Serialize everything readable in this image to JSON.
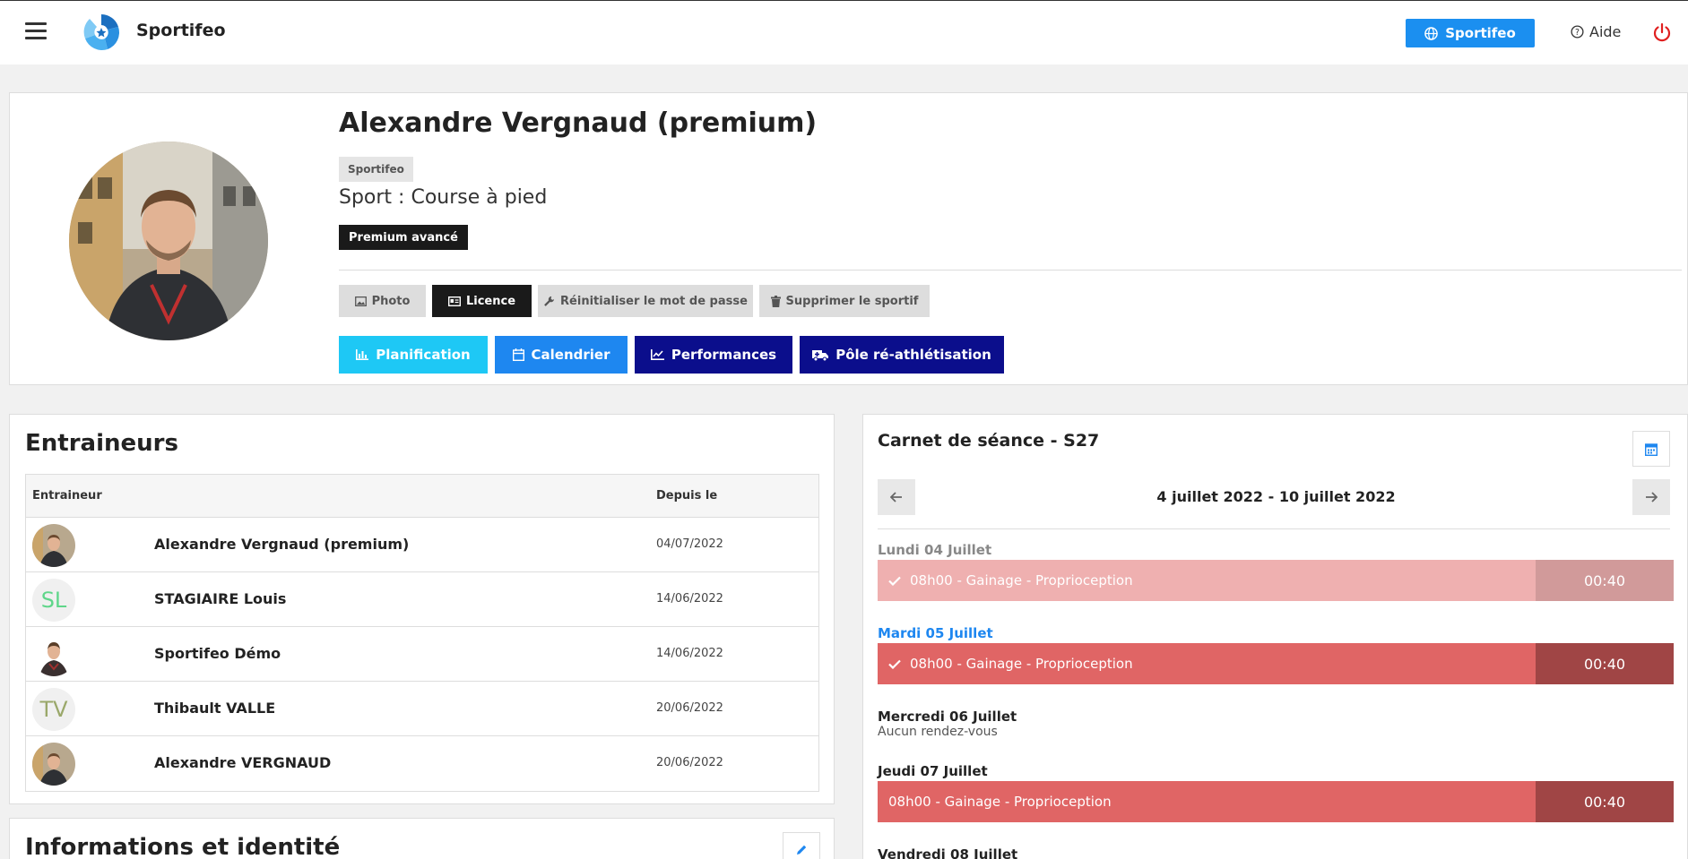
{
  "header": {
    "brand": "Sportifeo",
    "brand_button": "Sportifeo",
    "help": "Aide"
  },
  "profile": {
    "name": "Alexandre Vergnaud (premium)",
    "club": "Sportifeo",
    "sport": "Sport : Course à pied",
    "plan": "Premium avancé",
    "actions": {
      "photo": "Photo",
      "licence": "Licence",
      "reset_password": "Réinitialiser le mot de passe",
      "delete": "Supprimer le sportif"
    },
    "nav": {
      "planification": "Planification",
      "calendrier": "Calendrier",
      "performances": "Performances",
      "pole": "Pôle ré-athlétisation"
    }
  },
  "trainers": {
    "title": "Entraineurs",
    "col_trainer": "Entraineur",
    "col_since": "Depuis le",
    "rows": [
      {
        "name": "Alexandre Vergnaud (premium)",
        "date": "04/07/2022"
      },
      {
        "name": "STAGIAIRE Louis",
        "date": "14/06/2022",
        "initials": "SL"
      },
      {
        "name": "Sportifeo Démo",
        "date": "14/06/2022"
      },
      {
        "name": "Thibault VALLE",
        "date": "20/06/2022",
        "initials": "TV"
      },
      {
        "name": "Alexandre VERGNAUD",
        "date": "20/06/2022"
      }
    ]
  },
  "info": {
    "title": "Informations et identité"
  },
  "sessions": {
    "title": "Carnet de séance - S27",
    "range": "4 juillet 2022 - 10 juillet 2022",
    "days": [
      {
        "label": "Lundi 04 Juillet",
        "event": "08h00 - Gainage - Proprioception",
        "duration": "00:40"
      },
      {
        "label": "Mardi 05 Juillet",
        "event": "08h00 - Gainage - Proprioception",
        "duration": "00:40"
      },
      {
        "label": "Mercredi 06 Juillet",
        "none": "Aucun rendez-vous"
      },
      {
        "label": "Jeudi 07 Juillet",
        "event": "08h00 - Gainage - Proprioception",
        "duration": "00:40"
      },
      {
        "label": "Vendredi 08 Juillet"
      }
    ]
  },
  "colors": {
    "brand_blue": "#1b8ff0",
    "planification": "#1ec8f5",
    "calendrier": "#1e87f0",
    "performances": "#0b0e8c",
    "pole": "#0b0e8c",
    "event_past": "#efb0b0",
    "event_past_dur": "#d19a9a",
    "event": "#e06565",
    "event_dur": "#a04545",
    "today": "#1e87f0"
  }
}
